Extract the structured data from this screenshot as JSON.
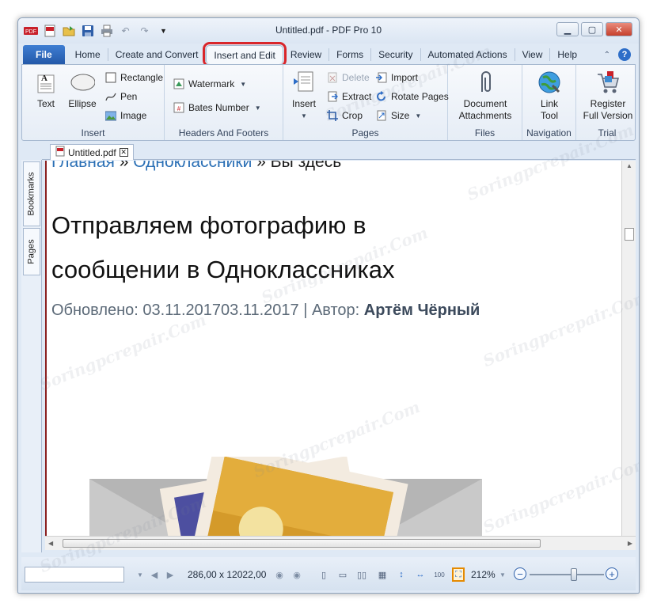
{
  "window": {
    "title": "Untitled.pdf - PDF Pro 10",
    "qat_icons": [
      "app-logo-icon",
      "open-pdf-icon",
      "open-folder-icon",
      "save-icon",
      "print-icon",
      "undo-icon",
      "redo-icon",
      "customize-icon"
    ]
  },
  "tabs": {
    "file": "File",
    "home": "Home",
    "create": "Create and Convert",
    "insert_edit": "Insert and Edit",
    "review": "Review",
    "forms": "Forms",
    "security": "Security",
    "automated": "Automated Actions",
    "view": "View",
    "help": "Help",
    "help_icon": "?"
  },
  "ribbon": {
    "insert": {
      "label": "Insert",
      "text": "Text",
      "ellipse": "Ellipse",
      "rectangle": "Rectangle",
      "pen": "Pen",
      "image": "Image"
    },
    "headers": {
      "label": "Headers And Footers",
      "watermark": "Watermark",
      "bates": "Bates Number"
    },
    "pages": {
      "label": "Pages",
      "insert": "Insert",
      "delete": "Delete",
      "extract": "Extract",
      "crop": "Crop",
      "import": "Import",
      "rotate": "Rotate Pages",
      "size": "Size"
    },
    "files": {
      "label": "Files",
      "attachments_line1": "Document",
      "attachments_line2": "Attachments"
    },
    "navigation": {
      "label": "Navigation",
      "link_line1": "Link",
      "link_line2": "Tool"
    },
    "trial": {
      "label": "Trial",
      "register_line1": "Register",
      "register_line2": "Full Version"
    }
  },
  "document": {
    "tab_name": "Untitled.pdf",
    "side_tabs": {
      "bookmarks": "Bookmarks",
      "pages": "Pages"
    },
    "breadcrumb_home": "Главная",
    "breadcrumb_sep1": " » ",
    "breadcrumb_section": "Одноклассники",
    "breadcrumb_sep2": " » ",
    "breadcrumb_current": "Вы здесь",
    "headline_line1": "Отправляем фотографию в",
    "headline_line2": "сообщении в Одноклассниках",
    "meta_prefix": "Обновлено: 03.11.201703.11.2017 | Автор: ",
    "meta_author": "Артём Чёрный"
  },
  "status": {
    "page_size": "286,00 x 12022,00",
    "zoom": "212%"
  },
  "watermark_text": "Soringpcrepair.Com",
  "colors": {
    "accent": "#2459a9",
    "highlight": "#d9252a",
    "link": "#2a6fb5",
    "envelope": "#b5b5b5",
    "photo_frame": "#f3ebe0",
    "photo_gold": "#d49a2a"
  }
}
